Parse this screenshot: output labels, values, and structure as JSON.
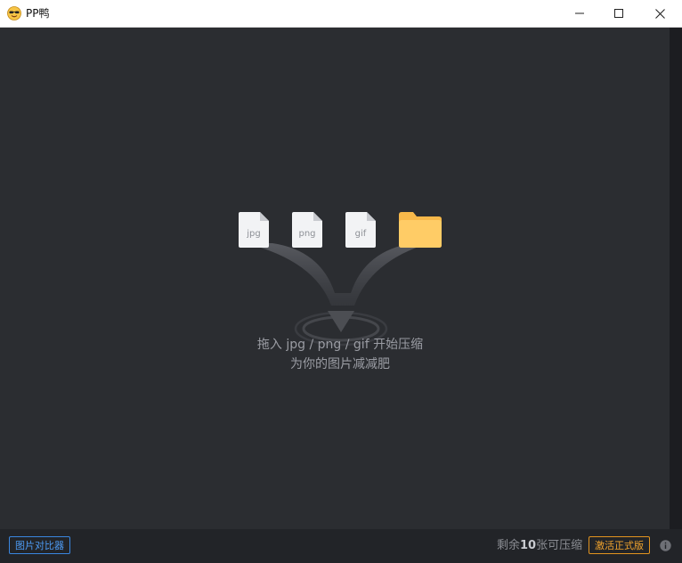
{
  "window": {
    "title": "PP鸭"
  },
  "drop_area": {
    "file_types": [
      "jpg",
      "png",
      "gif"
    ],
    "hint_line1": "拖入 jpg / png / gif 开始压缩",
    "hint_line2": "为你的图片减减肥"
  },
  "bottom_bar": {
    "compare_button_label": "图片对比器",
    "remain_prefix": "剩余",
    "remain_count": "10",
    "remain_suffix": "张可压缩",
    "activate_button_label": "激活正式版"
  },
  "icons": {
    "app": "duck-face-icon",
    "minimize": "minimize-icon",
    "maximize": "maximize-icon",
    "close": "close-icon",
    "folder": "folder-icon",
    "info": "info-icon"
  },
  "colors": {
    "background": "#2b2d31",
    "bottom_bar": "#222428",
    "accent_blue": "#3a86e0",
    "accent_orange": "#e2941f",
    "folder_yellow": "#ffcc66"
  }
}
